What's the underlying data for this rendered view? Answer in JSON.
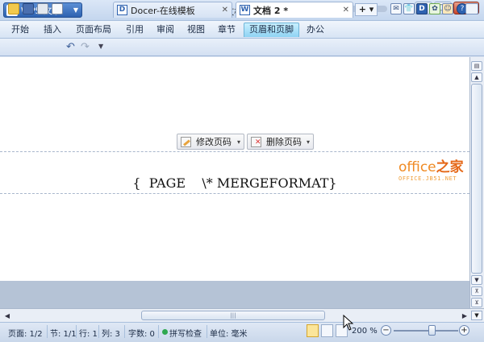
{
  "title_bar": {
    "app_button_label": "WPS 文字",
    "app_logo": "W",
    "document_title": "文档 2 *",
    "min_glyph": "▁",
    "max_glyph": "□",
    "close_glyph": "✕"
  },
  "menu": {
    "items": [
      {
        "label": "开始"
      },
      {
        "label": "插入"
      },
      {
        "label": "页面布局"
      },
      {
        "label": "引用"
      },
      {
        "label": "审阅"
      },
      {
        "label": "视图"
      },
      {
        "label": "章节"
      },
      {
        "label": "页眉和页脚",
        "active": true
      },
      {
        "label": "办公"
      }
    ],
    "d_icon_label": "D",
    "help_glyph": "?"
  },
  "tabs": [
    {
      "label": "Docer-在线模板",
      "icon": "D",
      "close": "✕"
    },
    {
      "label": "文档 2 *",
      "icon": "W",
      "close": "✕"
    }
  ],
  "tab_add_label": "+ ▾",
  "document": {
    "edit_page_number_label": "修改页码",
    "delete_page_number_label": "删除页码",
    "caret": "▾",
    "field_code": "{  PAGE    \\* MERGEFORMAT}",
    "watermark_main": "office",
    "watermark_main_cn": "之家",
    "watermark_sub": "OFFICE.JB51.NET"
  },
  "scrollbars": {
    "up": "▲",
    "down": "▼",
    "prev": "⊼",
    "next": "⊻",
    "left": "◀",
    "right": "▶",
    "grip": "|||"
  },
  "status": {
    "page": "页面: 1/2",
    "section": "节: 1/1",
    "line": "行: 1",
    "column": "列: 3",
    "word_count": "字数: 0",
    "spell_check": "拼写检查",
    "unit": "单位: 毫米",
    "zoom": "200 %",
    "zoom_out": "−",
    "zoom_in": "+"
  },
  "colors": {
    "accent": "#2e62b0",
    "active_menu": "#8fd3f3",
    "watermark": "#f08a22"
  }
}
